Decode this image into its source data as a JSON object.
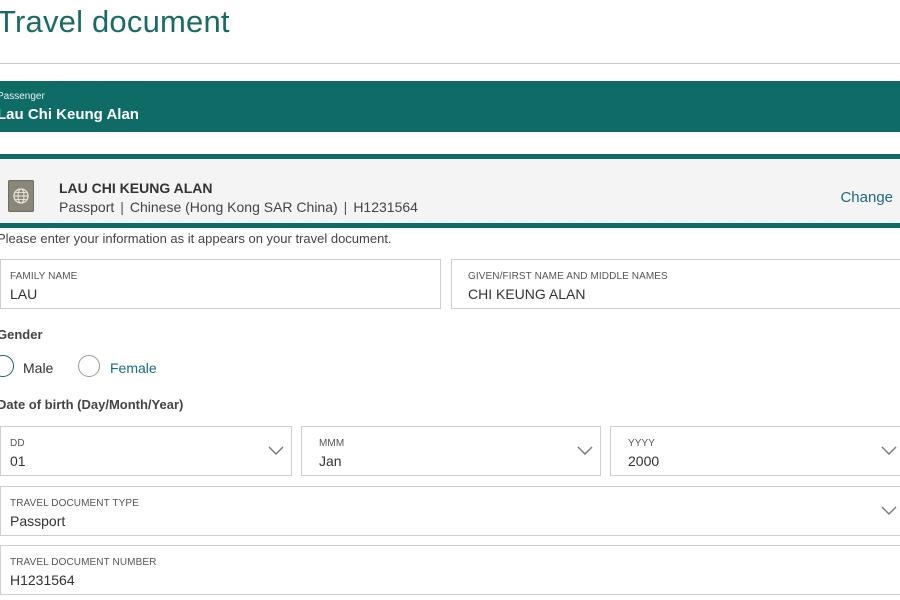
{
  "page": {
    "title": "Travel document"
  },
  "passenger": {
    "label": "Passenger",
    "name": "Lau Chi Keung Alan"
  },
  "document_card": {
    "name": "LAU CHI KEUNG ALAN",
    "type": "Passport",
    "nationality": "Chinese (Hong Kong SAR China)",
    "number": "H1231564",
    "change_label": "Change",
    "icon": "passport-icon"
  },
  "form": {
    "instruction": "Please enter your information as it appears on your travel document.",
    "family_name": {
      "label": "FAMILY NAME",
      "value": "LAU"
    },
    "given_name": {
      "label": "GIVEN/FIRST NAME AND MIDDLE NAMES",
      "value": "CHI KEUNG ALAN"
    },
    "gender": {
      "label": "Gender",
      "options": [
        {
          "label": "Male",
          "selected": true
        },
        {
          "label": "Female",
          "selected": false
        }
      ]
    },
    "dob": {
      "label": "Date of birth (Day/Month/Year)",
      "day": {
        "label": "DD",
        "value": "01"
      },
      "month": {
        "label": "MMM",
        "value": "Jan"
      },
      "year": {
        "label": "YYYY",
        "value": "2000"
      }
    },
    "doc_type": {
      "label": "TRAVEL DOCUMENT TYPE",
      "value": "Passport"
    },
    "doc_number": {
      "label": "TRAVEL DOCUMENT NUMBER",
      "value": "H1231564"
    }
  },
  "colors": {
    "brand": "#0e6b66",
    "link": "#1a6b8a"
  }
}
